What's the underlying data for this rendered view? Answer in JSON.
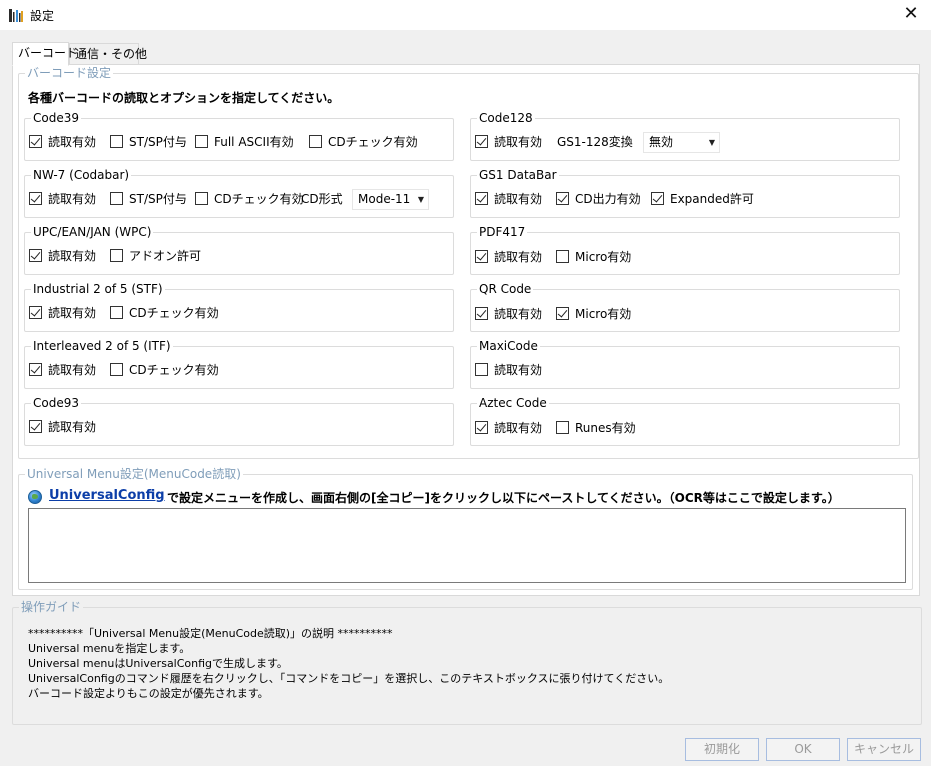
{
  "window": {
    "title": "設定",
    "close_glyph": "✕"
  },
  "tabs": [
    {
      "label": "バーコード",
      "active": true
    },
    {
      "label": "通信・その他",
      "active": false
    }
  ],
  "barcode_settings": {
    "legend": "バーコード設定",
    "instruction": "各種バーコードの読取とオプションを指定してください。",
    "groups": {
      "code39": {
        "title": "Code39",
        "options": [
          {
            "label": "読取有効",
            "checked": true
          },
          {
            "label": "ST/SP付与",
            "checked": false
          },
          {
            "label": "Full ASCII有効",
            "checked": false
          },
          {
            "label": "CDチェック有効",
            "checked": false
          }
        ]
      },
      "nw7": {
        "title": "NW-7 (Codabar)",
        "options": [
          {
            "label": "読取有効",
            "checked": true
          },
          {
            "label": "ST/SP付与",
            "checked": false
          },
          {
            "label": "CDチェック有効",
            "checked": false
          }
        ],
        "select_label": "CD形式",
        "select_value": "Mode-11"
      },
      "upc": {
        "title": "UPC/EAN/JAN (WPC)",
        "options": [
          {
            "label": "読取有効",
            "checked": true
          },
          {
            "label": "アドオン許可",
            "checked": false
          }
        ]
      },
      "i2of5": {
        "title": "Industrial 2 of 5 (STF)",
        "options": [
          {
            "label": "読取有効",
            "checked": true
          },
          {
            "label": "CDチェック有効",
            "checked": false
          }
        ]
      },
      "itf": {
        "title": "Interleaved 2 of 5 (ITF)",
        "options": [
          {
            "label": "読取有効",
            "checked": true
          },
          {
            "label": "CDチェック有効",
            "checked": false
          }
        ]
      },
      "code93": {
        "title": "Code93",
        "options": [
          {
            "label": "読取有効",
            "checked": true
          }
        ]
      },
      "code128": {
        "title": "Code128",
        "options": [
          {
            "label": "読取有効",
            "checked": true
          }
        ],
        "select_label": "GS1-128変換",
        "select_value": "無効"
      },
      "gs1databar": {
        "title": "GS1 DataBar",
        "options": [
          {
            "label": "読取有効",
            "checked": true
          },
          {
            "label": "CD出力有効",
            "checked": true
          },
          {
            "label": "Expanded許可",
            "checked": true
          }
        ]
      },
      "pdf417": {
        "title": "PDF417",
        "options": [
          {
            "label": "読取有効",
            "checked": true
          },
          {
            "label": "Micro有効",
            "checked": false
          }
        ]
      },
      "qrcode": {
        "title": "QR Code",
        "options": [
          {
            "label": "読取有効",
            "checked": true
          },
          {
            "label": "Micro有効",
            "checked": true
          }
        ]
      },
      "maxicode": {
        "title": "MaxiCode",
        "options": [
          {
            "label": "読取有効",
            "checked": false
          }
        ]
      },
      "aztec": {
        "title": "Aztec Code",
        "options": [
          {
            "label": "読取有効",
            "checked": true
          },
          {
            "label": "Runes有効",
            "checked": false
          }
        ]
      }
    }
  },
  "universal_menu": {
    "legend": "Universal Menu設定(MenuCode読取)",
    "link_text": "UniversalConfig",
    "description": "で設定メニューを作成し、画面右側の[全コピー]をクリックし以下にペーストしてください。（OCR等はここで設定します。）",
    "textbox_value": ""
  },
  "guide": {
    "legend": "操作ガイド",
    "lines": [
      "**********「Universal Menu設定(MenuCode読取)」の説明 **********",
      "Universal menuを指定します。",
      "Universal menuはUniversalConfigで生成します。",
      "UniversalConfigのコマンド履歴を右クリックし、「コマンドをコピー」を選択し、このテキストボックスに張り付けてください。",
      "バーコード設定よりもこの設定が優先されます。"
    ]
  },
  "buttons": {
    "reset": "初期化",
    "ok": "OK",
    "cancel": "キャンセル"
  }
}
